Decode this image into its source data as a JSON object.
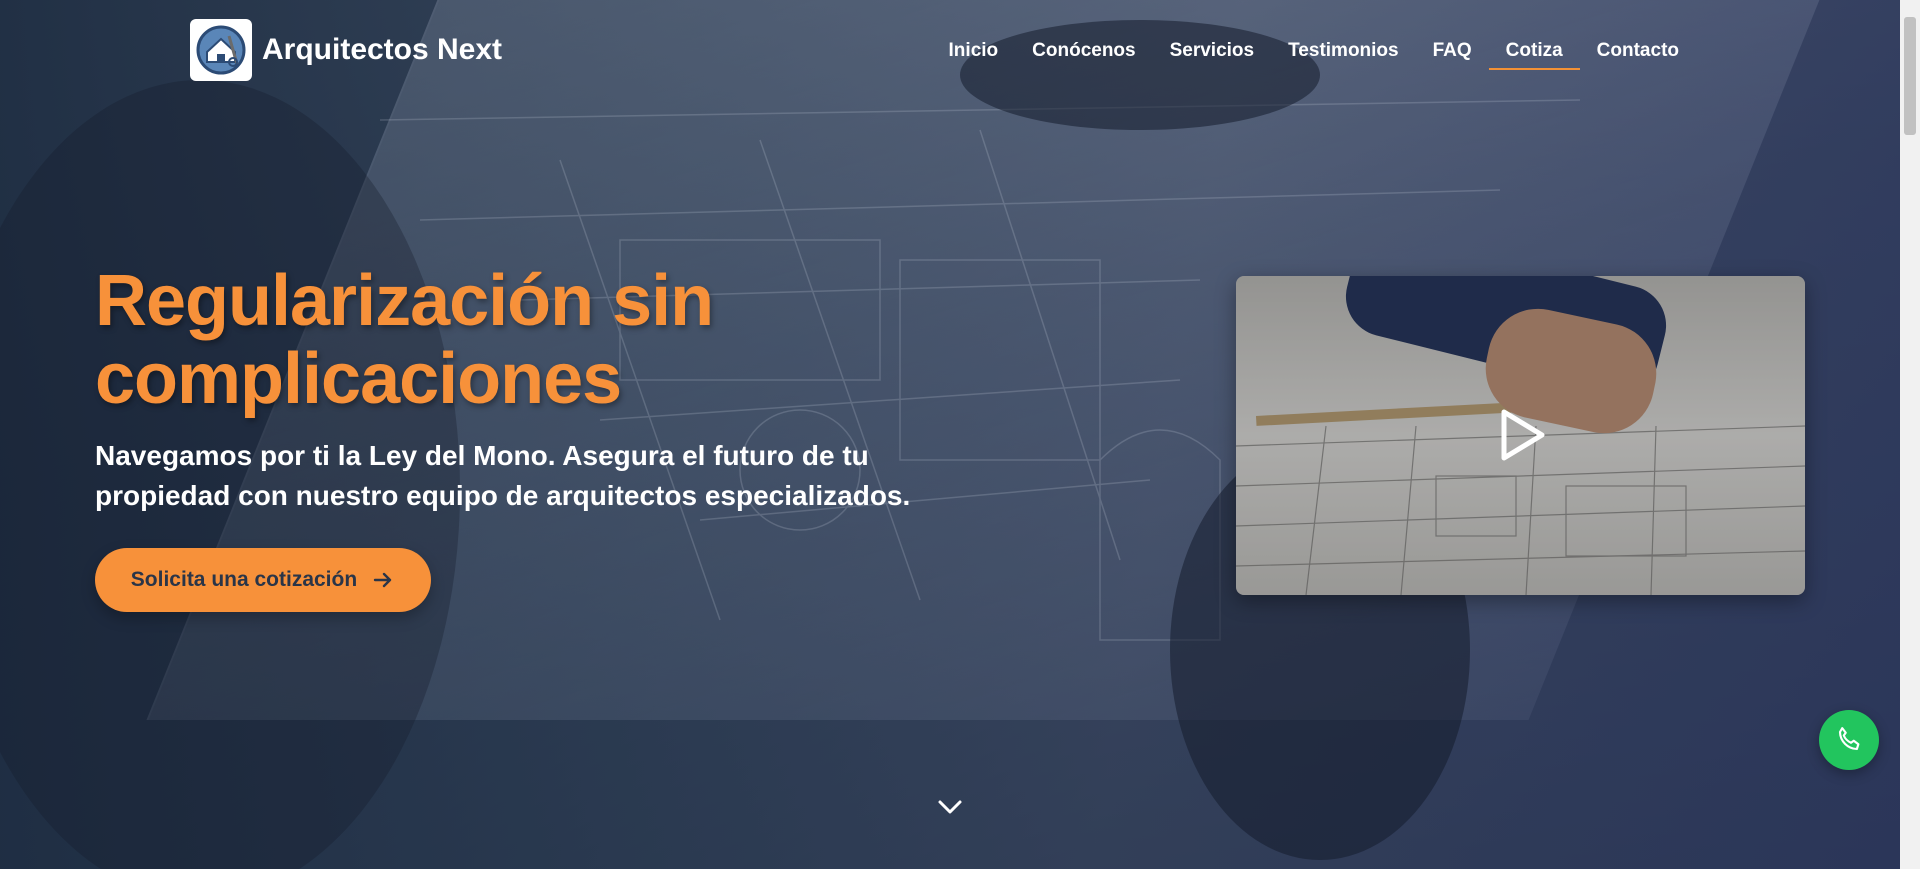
{
  "brand": {
    "name": "Arquitectos Next"
  },
  "nav": {
    "items": [
      {
        "label": "Inicio",
        "active": false
      },
      {
        "label": "Conócenos",
        "active": false
      },
      {
        "label": "Servicios",
        "active": false
      },
      {
        "label": "Testimonios",
        "active": false
      },
      {
        "label": "FAQ",
        "active": false
      },
      {
        "label": "Cotiza",
        "active": true
      },
      {
        "label": "Contacto",
        "active": false
      }
    ]
  },
  "hero": {
    "title_line1": "Regularización sin",
    "title_line2": "complicaciones",
    "subtitle": "Navegamos por ti la Ley del Mono. Asegura el futuro de tu propiedad con nuestro equipo de arquitectos especializados.",
    "cta_label": "Solicita una cotización"
  },
  "icons": {
    "cta": "arrow-right-icon",
    "video": "play-icon",
    "phone": "phone-icon",
    "scroll": "chevron-down-icon"
  },
  "colors": {
    "accent": "#f7913a",
    "phone_button": "#22c55e",
    "text": "#ffffff"
  }
}
